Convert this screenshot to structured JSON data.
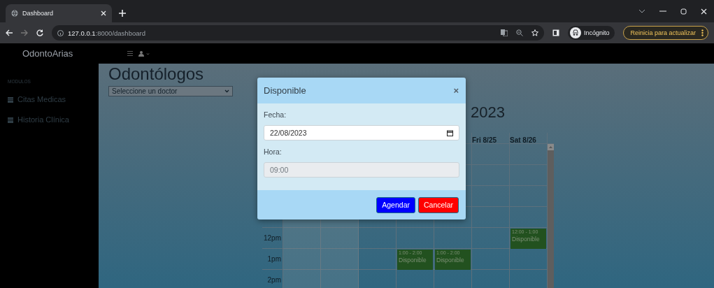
{
  "browser": {
    "tab_title": "Dashboard",
    "url_host": "127.0.0.1",
    "url_rest": ":8000/dashboard",
    "profile": "Incógnito",
    "update_button": "Reinicia para actualizar"
  },
  "navbar": {
    "brand": "OdontoArias"
  },
  "sidebar": {
    "heading": "MODULOS",
    "items": [
      {
        "label": "Citas Medicas"
      },
      {
        "label": "Historia Clínica"
      }
    ]
  },
  "page": {
    "title": "Odontólogos",
    "doctor_select": "Seleccione un doctor"
  },
  "calendar": {
    "title": "2023",
    "days": [
      {
        "shaded": true
      },
      {
        "shaded": true
      },
      {
        "shaded": false
      },
      {
        "shaded": false
      },
      {
        "shaded": false
      },
      {
        "shaded": false,
        "header": "Fri 8/25"
      },
      {
        "shaded": false,
        "header": "Sat 8/26"
      }
    ],
    "rows": [
      {
        "time": "12pm",
        "cells": [
          {},
          {},
          {},
          {},
          {},
          {},
          {
            "kind": "event",
            "time": "12:00 - 1:00",
            "label": "Disponible"
          }
        ]
      },
      {
        "time": "1pm",
        "cells": [
          {},
          {},
          {},
          {
            "kind": "event",
            "time": "1:00 - 2:00",
            "label": "Disponible"
          },
          {
            "kind": "event",
            "time": "1:00 - 2:00",
            "label": "Disponible"
          },
          {},
          {}
        ]
      },
      {
        "time": "2pm",
        "cells": [
          {},
          {},
          {},
          {},
          {},
          {},
          {}
        ]
      }
    ]
  },
  "modal": {
    "title": "Disponible",
    "close": "×",
    "fields": [
      {
        "label": "Fecha:",
        "value": "22/08/2023",
        "disabled": false
      },
      {
        "label": "Hora:",
        "value": "09:00",
        "disabled": true
      }
    ],
    "buttons": [
      {
        "label": "Agendar",
        "kind": "primary"
      },
      {
        "label": "Cancelar",
        "kind": "danger"
      }
    ]
  }
}
